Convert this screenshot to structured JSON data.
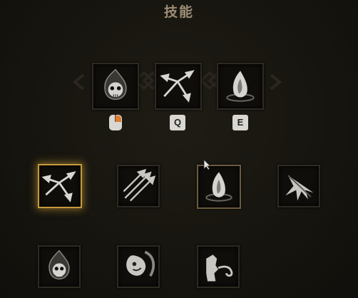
{
  "title": "技能",
  "equipped": {
    "slots": [
      {
        "icon": "skull-flame-icon",
        "binding": "mouse-icon"
      },
      {
        "icon": "arrow-split-icon",
        "binding": "Q"
      },
      {
        "icon": "flame-egg-icon",
        "binding": "E"
      }
    ]
  },
  "keys": {
    "q": "Q",
    "e": "E"
  },
  "skills": {
    "row1": [
      "arrow-split-icon",
      "triple-arrows-icon",
      "flame-egg-icon",
      "spear-burst-icon"
    ],
    "row2": [
      "skull-flame-icon",
      "gust-beast-icon",
      "wind-breath-icon"
    ]
  },
  "colors": {
    "accent": "#c49a3c",
    "title": "#9c8e75"
  }
}
